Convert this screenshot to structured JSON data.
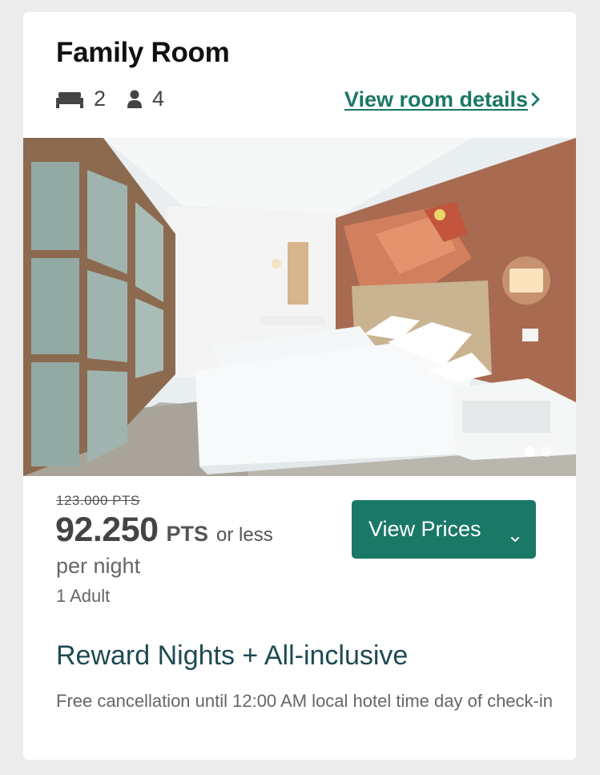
{
  "room": {
    "title": "Family Room",
    "beds_count": "2",
    "guests_capacity": "4",
    "details_link_label": "View room details",
    "bed_icon": "bed-icon",
    "person_icon": "person-icon"
  },
  "gallery": {
    "image_alt": "Hotel room with two white beds, mural wall and sliding wooden doors",
    "total_images": 2,
    "active_index": 0
  },
  "pricing": {
    "original_price": "123.000 PTS",
    "current_price": "92.250",
    "currency": "PTS",
    "qualifier": "or less",
    "per_night": "per night",
    "occupancy": "1 Adult",
    "button_label": "View Prices"
  },
  "rate": {
    "name": "Reward Nights + All-inclusive",
    "policy": "Free cancellation until 12:00 AM local hotel time day of check-in"
  },
  "colors": {
    "accent": "#1a7866",
    "rate_title": "#1d4a52",
    "background": "#ececec",
    "card": "#ffffff"
  }
}
